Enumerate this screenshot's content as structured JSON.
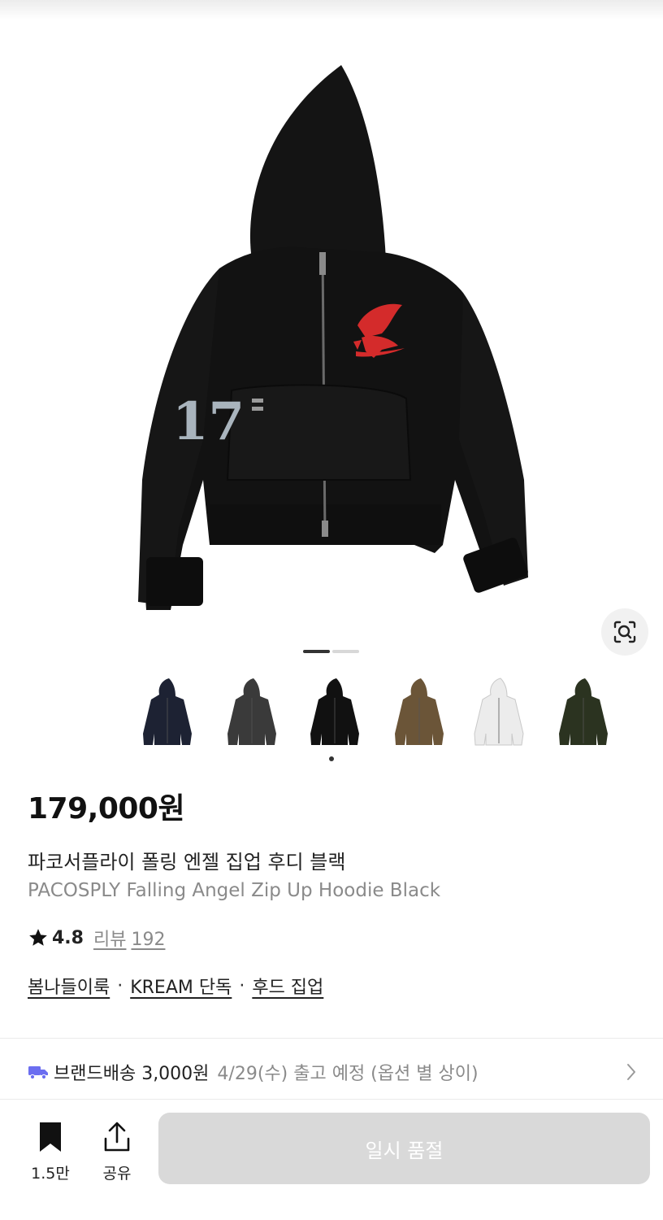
{
  "gallery": {
    "main_image": "black zip-up hoodie with red pegasus logo and '17' sleeve patch",
    "sleeve_number": "17",
    "slide_count": 2,
    "active_slide": 1,
    "thumbnails": [
      {
        "color": "#1d2233",
        "name": "navy"
      },
      {
        "color": "#3a3a3a",
        "name": "charcoal"
      },
      {
        "color": "#111111",
        "name": "black"
      },
      {
        "color": "#6b5538",
        "name": "camo"
      },
      {
        "color": "#ececec",
        "name": "white"
      },
      {
        "color": "#2b3320",
        "name": "olive"
      }
    ],
    "selected_thumbnail": 2,
    "lens_icon": "image-search-icon"
  },
  "product": {
    "price": "179,000원",
    "title_ko": "파코서플라이 폴링 엔젤 집업 후디 블랙",
    "title_en": "PACOSPLY Falling Angel Zip Up Hoodie Black",
    "rating": "4.8",
    "review_label": "리뷰",
    "review_count": "192",
    "tags": [
      "봄나들이룩",
      "KREAM 단독",
      "후드 집업"
    ]
  },
  "shipping": {
    "icon": "truck-icon",
    "label": "브랜드배송 3,000원",
    "date": "4/29(수) 출고 예정 (옵션 별 상이)",
    "icon_color": "#6b6ef0"
  },
  "bottom_bar": {
    "bookmark_count": "1.5만",
    "share_label": "공유",
    "buy_button_label": "일시 품절"
  },
  "colors": {
    "accent_red": "#d42b2b",
    "disabled_button": "#d9d9d9",
    "muted_text": "#8a8a8a"
  }
}
